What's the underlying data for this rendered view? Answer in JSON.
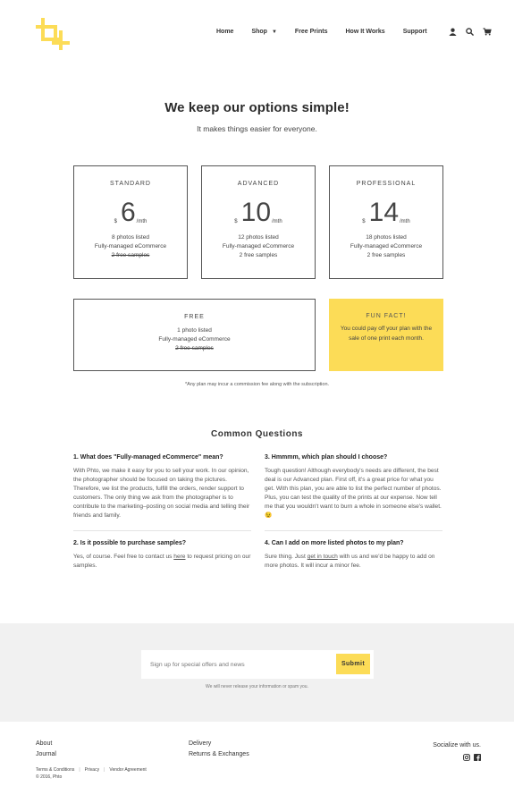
{
  "brand": {
    "logo_icon": "crop-plus-icon",
    "accent_color": "#fcdc57"
  },
  "nav": {
    "home": "Home",
    "shop": "Shop",
    "free_prints": "Free Prints",
    "how_it_works": "How It Works",
    "support": "Support",
    "icons": [
      "user-icon",
      "search-icon",
      "cart-icon"
    ]
  },
  "hero": {
    "title": "We keep our options simple!",
    "subtitle": "It makes things easier for everyone."
  },
  "plans": [
    {
      "name": "STANDARD",
      "currency": "$",
      "amount": "6",
      "period": "/mth",
      "features": [
        "8 photos listed",
        "Fully-managed eCommerce"
      ],
      "struck": "2 free samples"
    },
    {
      "name": "ADVANCED",
      "currency": "$",
      "amount": "10",
      "period": "/mth",
      "features": [
        "12 photos listed",
        "Fully-managed eCommerce",
        "2 free samples"
      ]
    },
    {
      "name": "PROFESSIONAL",
      "currency": "$",
      "amount": "14",
      "period": "/mth",
      "features": [
        "18 photos listed",
        "Fully-managed eCommerce",
        "2 free samples"
      ]
    },
    {
      "name": "FREE",
      "features": [
        "1 photo listed",
        "Fully-managed eCommerce"
      ],
      "struck": "2 free samples"
    }
  ],
  "fun_fact": {
    "title": "FUN FACT!",
    "body": "You could pay off your plan with the sale of one print each month."
  },
  "footnote": "*Any plan may incur a commission fee along with the subscription.",
  "faq": {
    "title": "Common Questions",
    "items": [
      {
        "q": "1. What does \"Fully-managed eCommerce\" mean?",
        "a": "With Phto, we make it easy for you to sell your work. In our opinion, the photographer should be focused on taking the pictures. Therefore, we list the products, fulfill the orders, render support to customers. The only thing we ask from the photographer is to contribute to the marketing–posting on social media and telling their friends and family."
      },
      {
        "q": "3. Hmmmm, which plan should I choose?",
        "a": "Tough question! Although everybody's needs are different, the best deal is our Advanced plan. First off, it's a great price for what you get. With this plan, you are able to list the perfect number of photos. Plus, you can test the quality of the prints at our expense. Now tell me that you wouldn't want to burn a whole in someone else's wallet. 😉"
      },
      {
        "q": "2. Is it possible to purchase samples?",
        "a_pre": "Yes, of course. Feel free to contact us ",
        "a_link": "here",
        "a_post": " to request pricing on our samples."
      },
      {
        "q": "4. Can I add on more listed photos to my plan?",
        "a_pre": "Sure thing. Just ",
        "a_link": "get in touch",
        "a_post": " with us and we'd be happy to add on more photos. It will incur a minor fee."
      }
    ]
  },
  "newsletter": {
    "placeholder": "Sign up for special offers and news",
    "button": "Submit",
    "note": "We will never release your information or spam you."
  },
  "footer": {
    "col1": [
      "About",
      "Journal"
    ],
    "col2": [
      "Delivery",
      "Returns & Exchanges"
    ],
    "social_label": "Socialize with us.",
    "social_icons": [
      "instagram-icon",
      "facebook-icon"
    ],
    "legal": [
      "Terms & Conditions",
      "Privacy",
      "Vendor Agreement"
    ],
    "copyright": "© 2016, Phto"
  }
}
